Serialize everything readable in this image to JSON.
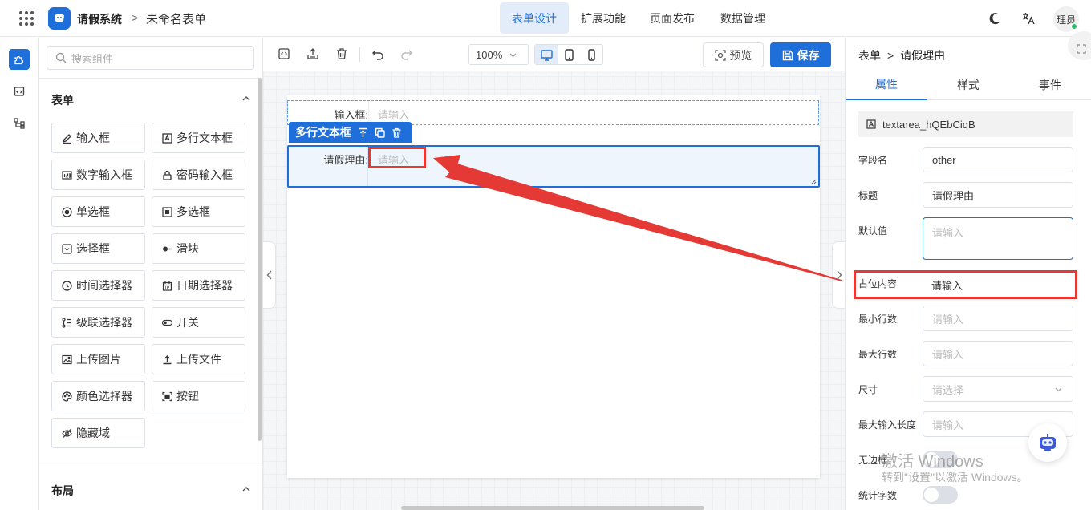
{
  "header": {
    "app_name": "请假系统",
    "breadcrumb_sep": ">",
    "form_name": "未命名表单",
    "nav": [
      "表单设计",
      "扩展功能",
      "页面发布",
      "数据管理"
    ],
    "user_name": "理员"
  },
  "sidebar": {
    "search_placeholder": "搜索组件",
    "section_form": "表单",
    "components": [
      "输入框",
      "多行文本框",
      "数字输入框",
      "密码输入框",
      "单选框",
      "多选框",
      "选择框",
      "滑块",
      "时间选择器",
      "日期选择器",
      "级联选择器",
      "开关",
      "上传图片",
      "上传文件",
      "颜色选择器",
      "按钮",
      "隐藏域"
    ],
    "section_layout": "布局"
  },
  "toolbar": {
    "zoom": "100%",
    "preview_label": "预览",
    "save_label": "保存"
  },
  "canvas": {
    "field1_label": "输入框",
    "field1_placeholder": "请输入",
    "selected_tag": "多行文本框",
    "field2_label": "请假理由",
    "field2_placeholder": "请输入"
  },
  "props": {
    "breadcrumb_root": "表单",
    "breadcrumb_sep": ">",
    "breadcrumb_leaf": "请假理由",
    "tabs": [
      "属性",
      "样式",
      "事件"
    ],
    "component_id": "textarea_hQEbCiqB",
    "field_name_label": "字段名",
    "field_name_value": "other",
    "title_label": "标题",
    "title_value": "请假理由",
    "default_label": "默认值",
    "default_placeholder": "请输入",
    "placeholder_label": "占位内容",
    "placeholder_value": "请输入",
    "min_rows_label": "最小行数",
    "min_rows_placeholder": "请输入",
    "max_rows_label": "最大行数",
    "max_rows_placeholder": "请输入",
    "size_label": "尺寸",
    "size_placeholder": "请选择",
    "max_len_label": "最大输入长度",
    "max_len_placeholder": "请输入",
    "borderless_label": "无边框",
    "count_label": "统计字数"
  },
  "watermark": {
    "line1": "激活 Windows",
    "line2": "转到\"设置\"以激活 Windows。"
  },
  "colors": {
    "primary": "#1f6fdb",
    "annotation_red": "#e53935"
  }
}
